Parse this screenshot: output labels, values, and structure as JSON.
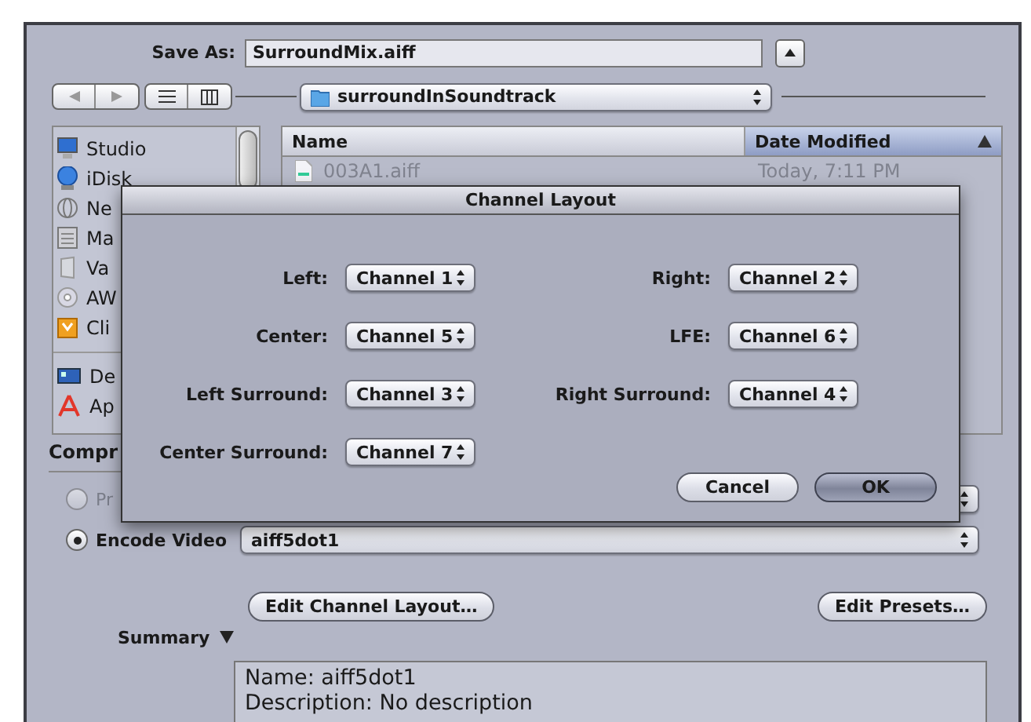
{
  "save_as": {
    "label": "Save As:",
    "value": "SurroundMix.aiff"
  },
  "location": "surroundInSoundtrack",
  "sidebar": {
    "groups": [
      [
        {
          "label": "Studio"
        },
        {
          "label": "iDisk"
        },
        {
          "label": "Ne"
        },
        {
          "label": "Ma"
        },
        {
          "label": "Va"
        },
        {
          "label": "AW"
        },
        {
          "label": "Cli"
        }
      ],
      [
        {
          "label": "De"
        },
        {
          "label": "Ap"
        }
      ]
    ]
  },
  "file_list": {
    "columns": [
      {
        "label": "Name",
        "sorted": false
      },
      {
        "label": "Date Modified",
        "sorted": true
      }
    ],
    "rows": [
      {
        "name": "003A1.aiff",
        "date": "Today, 7:11 PM"
      }
    ]
  },
  "compression": {
    "heading": "Compr",
    "options": [
      {
        "label": "Pr",
        "selected": false,
        "disabled": true
      },
      {
        "label": "Encode Video",
        "selected": true,
        "disabled": false,
        "value": "aiff5dot1"
      }
    ]
  },
  "buttons": [
    "Edit Channel Layout…",
    "Edit Presets…"
  ],
  "summary": {
    "label": "Summary",
    "expanded": true,
    "lines": [
      "Name: aiff5dot1",
      "Description: No description"
    ]
  },
  "dialog": {
    "title": "Channel Layout",
    "left": [
      {
        "label": "Left:",
        "value": "Channel 1"
      },
      {
        "label": "Center:",
        "value": "Channel 5"
      },
      {
        "label": "Left Surround:",
        "value": "Channel 3"
      },
      {
        "label": "Center Surround:",
        "value": "Channel 7"
      }
    ],
    "right": [
      {
        "label": "Right:",
        "value": "Channel 2"
      },
      {
        "label": "LFE:",
        "value": "Channel 6"
      },
      {
        "label": "Right Surround:",
        "value": "Channel 4"
      }
    ],
    "buttons": [
      {
        "label": "Cancel",
        "default": false
      },
      {
        "label": "OK",
        "default": true
      }
    ]
  }
}
